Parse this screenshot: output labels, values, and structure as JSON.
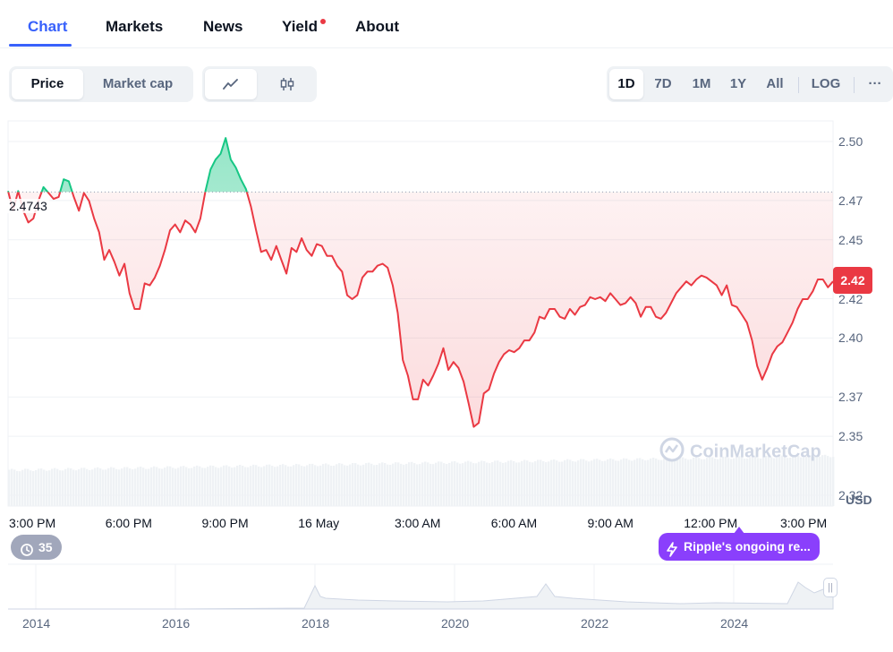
{
  "tabs": [
    {
      "label": "Chart",
      "active": true
    },
    {
      "label": "Markets",
      "active": false
    },
    {
      "label": "News",
      "active": false
    },
    {
      "label": "Yield",
      "active": false,
      "dot": true
    },
    {
      "label": "About",
      "active": false
    }
  ],
  "toolbar": {
    "price_label": "Price",
    "market_cap_label": "Market cap",
    "line_icon": "line-chart-icon",
    "candle_icon": "candlestick-icon",
    "ranges": [
      "1D",
      "7D",
      "1M",
      "1Y",
      "All"
    ],
    "active_range": "1D",
    "log_label": "LOG",
    "more_label": "···"
  },
  "chart": {
    "reference_price": "2.4743",
    "current_price": "2.42",
    "currency": "USD",
    "watermark": "CoinMarketCap",
    "history_count": "35",
    "event_label": "Ripple's ongoing re...",
    "year_ticks": [
      "2014",
      "2016",
      "2018",
      "2020",
      "2022",
      "2024"
    ]
  },
  "colors": {
    "accent": "#3861fb",
    "up": "#16c784",
    "down": "#ea3943",
    "event": "#8a3ffc"
  },
  "chart_data": {
    "type": "line",
    "y_ticks": [
      "2.50",
      "2.47",
      "2.45",
      "2.42",
      "2.40",
      "2.37",
      "2.35",
      "2.32"
    ],
    "x_ticks": [
      "3:00 PM",
      "6:00 PM",
      "9:00 PM",
      "16 May",
      "3:00 AM",
      "6:00 AM",
      "9:00 AM",
      "12:00 PM",
      "3:00 PM"
    ],
    "ylim": [
      2.3145,
      2.5105
    ],
    "reference_value": 2.4743,
    "series": [
      {
        "values": [
          2.4748,
          2.4648,
          2.4748,
          2.4648,
          2.4588,
          2.4608,
          2.4698,
          2.4768,
          2.4738,
          2.4708,
          2.4718,
          2.4808,
          2.4798,
          2.4718,
          2.4648,
          2.4738,
          2.4698,
          2.4608,
          2.4538,
          2.4398,
          2.4448,
          2.4388,
          2.4318,
          2.4378,
          2.4228,
          2.4148,
          2.4148,
          2.4278,
          2.4268,
          2.4308,
          2.4368,
          2.4448,
          2.4548,
          2.4578,
          2.4538,
          2.4598,
          2.4578,
          2.4538,
          2.4608,
          2.4748,
          2.4858,
          2.4908,
          2.4938,
          2.5018,
          2.4908,
          2.4868,
          2.4808,
          2.4758,
          2.4668,
          2.4548,
          2.4438,
          2.4448,
          2.4398,
          2.4468,
          2.4398,
          2.4328,
          2.4458,
          2.4438,
          2.4508,
          2.4448,
          2.4418,
          2.4478,
          2.4468,
          2.4418,
          2.4418,
          2.4368,
          2.4338,
          2.4218,
          2.4198,
          2.4218,
          2.4308,
          2.4338,
          2.4338,
          2.4368,
          2.4378,
          2.4358,
          2.4268,
          2.4128,
          2.3888,
          2.3808,
          2.3688,
          2.3688,
          2.3788,
          2.3758,
          2.3808,
          2.3868,
          2.3948,
          2.3838,
          2.3878,
          2.3848,
          2.3778,
          2.3668,
          2.3548,
          2.3568,
          2.3718,
          2.3738,
          2.3818,
          2.3878,
          2.3918,
          2.3938,
          2.3928,
          2.3948,
          2.3988,
          2.3988,
          2.4028,
          2.4108,
          2.4098,
          2.4148,
          2.4148,
          2.4108,
          2.4098,
          2.4148,
          2.4118,
          2.4158,
          2.4168,
          2.4208,
          2.4198,
          2.4208,
          2.4188,
          2.4228,
          2.4198,
          2.4168,
          2.4178,
          2.4208,
          2.4178,
          2.4108,
          2.4158,
          2.4158,
          2.4108,
          2.4098,
          2.4128,
          2.4178,
          2.4228,
          2.4258,
          2.4288,
          2.4268,
          2.4298,
          2.4318,
          2.4308,
          2.4288,
          2.4268,
          2.4218,
          2.4268,
          2.4168,
          2.4158,
          2.4118,
          2.4078,
          2.3988,
          2.3858,
          2.3788,
          2.3848,
          2.3918,
          2.3958,
          2.3978,
          2.4028,
          2.4078,
          2.4148,
          2.4198,
          2.4198,
          2.4238,
          2.4298,
          2.4298,
          2.4258,
          2.4288
        ]
      }
    ],
    "volume_note": "volume bars shown as light gray band",
    "grid": true
  }
}
